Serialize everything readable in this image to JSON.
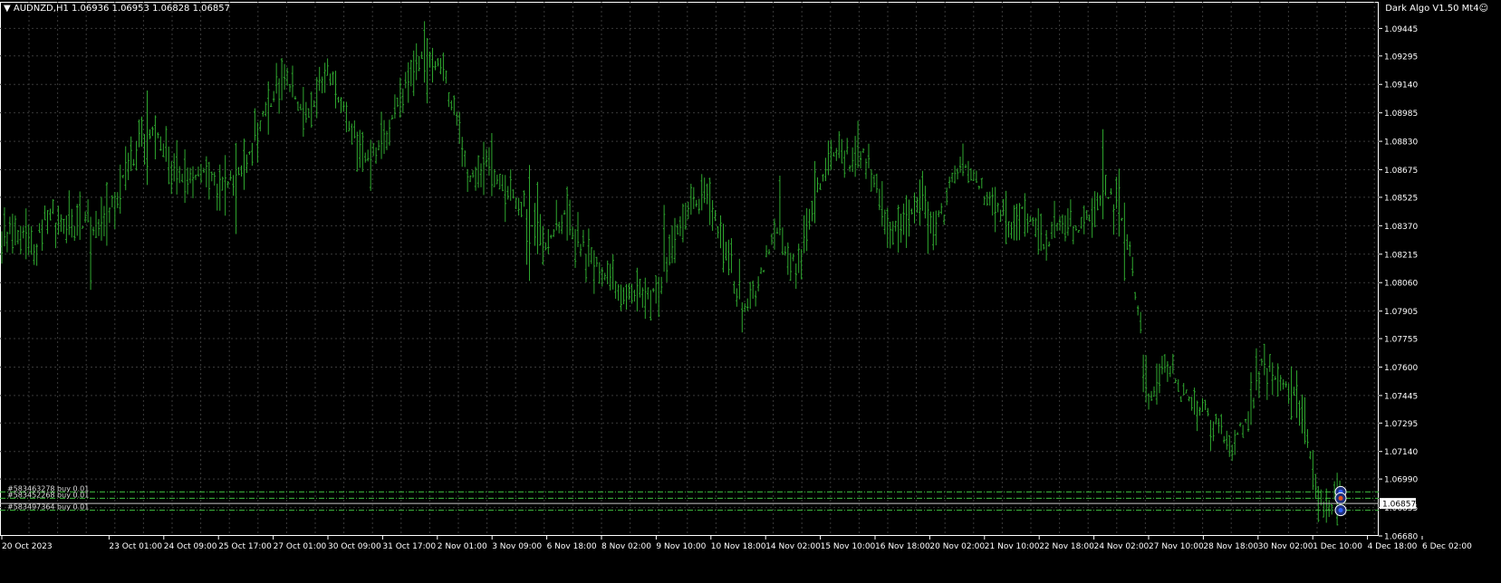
{
  "header": {
    "symbol_line": "▼ AUDNZD,H1  1.06936 1.06953 1.06828 1.06857",
    "expert_label": "Dark Algo V1.50 Mt4☺"
  },
  "colors": {
    "background": "#000000",
    "candles": "#2fa82f",
    "grid": "#3a3a3a",
    "axis_text": "#ffffff",
    "order_line": "#3fbf3f",
    "bid_line": "#c8c8c8"
  },
  "chart_data": {
    "type": "bar",
    "symbol": "AUDNZD",
    "timeframe": "H1",
    "ohlc_last": {
      "open": 1.06936,
      "high": 1.06953,
      "low": 1.06828,
      "close": 1.06857
    },
    "ylim": [
      1.0668,
      1.0959
    ],
    "price_ticks": [
      "1.09445",
      "1.09295",
      "1.09140",
      "1.08985",
      "1.08830",
      "1.08675",
      "1.08525",
      "1.08370",
      "1.08215",
      "1.08060",
      "1.07905",
      "1.07755",
      "1.07600",
      "1.07445",
      "1.07295",
      "1.07140",
      "1.06990",
      "1.06835",
      "1.06680"
    ],
    "time_ticks": [
      "20 Oct 2023",
      "23 Oct 01:00",
      "24 Oct 09:00",
      "25 Oct 17:00",
      "27 Oct 01:00",
      "30 Oct 09:00",
      "31 Oct 17:00",
      "2 Nov 01:00",
      "3 Nov 09:00",
      "6 Nov 18:00",
      "8 Nov 02:00",
      "9 Nov 10:00",
      "10 Nov 18:00",
      "14 Nov 02:00",
      "15 Nov 10:00",
      "16 Nov 18:00",
      "20 Nov 02:00",
      "21 Nov 10:00",
      "22 Nov 18:00",
      "24 Nov 02:00",
      "27 Nov 10:00",
      "28 Nov 18:00",
      "30 Nov 02:00",
      "1 Dec 10:00",
      "4 Dec 18:00",
      "6 Dec 02:00"
    ],
    "price_path": [
      [
        0,
        1.0834
      ],
      [
        8,
        1.0834
      ],
      [
        14,
        1.0828
      ],
      [
        18,
        1.0843
      ],
      [
        25,
        1.0838
      ],
      [
        32,
        1.084
      ],
      [
        38,
        1.0836
      ],
      [
        44,
        1.0848
      ],
      [
        50,
        1.0872
      ],
      [
        54,
        1.0885
      ],
      [
        58,
        1.0893
      ],
      [
        62,
        1.0878
      ],
      [
        66,
        1.087
      ],
      [
        72,
        1.0862
      ],
      [
        78,
        1.0865
      ],
      [
        84,
        1.0858
      ],
      [
        90,
        1.0862
      ],
      [
        96,
        1.0875
      ],
      [
        102,
        1.09
      ],
      [
        106,
        1.091
      ],
      [
        110,
        1.0912
      ],
      [
        114,
        1.0905
      ],
      [
        118,
        1.0898
      ],
      [
        122,
        1.0908
      ],
      [
        126,
        1.0922
      ],
      [
        130,
        1.0912
      ],
      [
        134,
        1.0895
      ],
      [
        138,
        1.088
      ],
      [
        142,
        1.0874
      ],
      [
        146,
        1.088
      ],
      [
        150,
        1.089
      ],
      [
        154,
        1.0902
      ],
      [
        158,
        1.0915
      ],
      [
        162,
        1.0928
      ],
      [
        166,
        1.093
      ],
      [
        170,
        1.0922
      ],
      [
        174,
        1.0905
      ],
      [
        178,
        1.0878
      ],
      [
        182,
        1.0862
      ],
      [
        186,
        1.0872
      ],
      [
        190,
        1.0868
      ],
      [
        194,
        1.0856
      ],
      [
        198,
        1.0852
      ],
      [
        202,
        1.0848
      ],
      [
        206,
        1.0835
      ],
      [
        210,
        1.0826
      ],
      [
        214,
        1.0836
      ],
      [
        218,
        1.0844
      ],
      [
        222,
        1.083
      ],
      [
        226,
        1.0822
      ],
      [
        230,
        1.0815
      ],
      [
        234,
        1.0808
      ],
      [
        238,
        1.08
      ],
      [
        242,
        1.0797
      ],
      [
        246,
        1.08
      ],
      [
        250,
        1.0796
      ],
      [
        254,
        1.08
      ],
      [
        258,
        1.0825
      ],
      [
        262,
        1.0836
      ],
      [
        266,
        1.0845
      ],
      [
        270,
        1.085
      ],
      [
        272,
        1.086
      ],
      [
        276,
        1.0838
      ],
      [
        280,
        1.0822
      ],
      [
        284,
        1.0806
      ],
      [
        288,
        1.079
      ],
      [
        292,
        1.0799
      ],
      [
        296,
        1.0822
      ],
      [
        300,
        1.0834
      ],
      [
        304,
        1.0826
      ],
      [
        308,
        1.0812
      ],
      [
        312,
        1.0836
      ],
      [
        316,
        1.0856
      ],
      [
        320,
        1.0876
      ],
      [
        324,
        1.0878
      ],
      [
        328,
        1.0872
      ],
      [
        332,
        1.088
      ],
      [
        336,
        1.087
      ],
      [
        340,
        1.085
      ],
      [
        344,
        1.083
      ],
      [
        348,
        1.0838
      ],
      [
        352,
        1.0844
      ],
      [
        356,
        1.0848
      ],
      [
        360,
        1.0835
      ],
      [
        364,
        1.0842
      ],
      [
        368,
        1.0862
      ],
      [
        372,
        1.0872
      ],
      [
        376,
        1.0866
      ],
      [
        380,
        1.0852
      ],
      [
        384,
        1.085
      ],
      [
        388,
        1.0842
      ],
      [
        392,
        1.0838
      ],
      [
        396,
        1.0845
      ],
      [
        400,
        1.0835
      ],
      [
        404,
        1.0828
      ],
      [
        408,
        1.0836
      ],
      [
        412,
        1.0838
      ],
      [
        416,
        1.083
      ],
      [
        420,
        1.084
      ],
      [
        424,
        1.0852
      ],
      [
        428,
        1.0855
      ],
      [
        432,
        1.0848
      ],
      [
        436,
        1.083
      ],
      [
        440,
        1.079
      ],
      [
        444,
        1.074
      ],
      [
        448,
        1.0755
      ],
      [
        452,
        1.0762
      ],
      [
        456,
        1.0748
      ],
      [
        460,
        1.074
      ],
      [
        464,
        1.0738
      ],
      [
        468,
        1.0728
      ],
      [
        472,
        1.0727
      ],
      [
        476,
        1.071
      ],
      [
        480,
        1.0727
      ],
      [
        484,
        1.0743
      ],
      [
        488,
        1.076
      ],
      [
        492,
        1.0757
      ],
      [
        496,
        1.0748
      ],
      [
        500,
        1.0742
      ],
      [
        504,
        1.0736
      ],
      [
        506,
        1.072
      ],
      [
        508,
        1.0693
      ],
      [
        512,
        1.0682
      ],
      [
        516,
        1.0686
      ],
      [
        520,
        1.0688
      ]
    ]
  },
  "orders": [
    {
      "label": "#583463278 buy 0.01",
      "price": 1.0692
    },
    {
      "label": "#583452268 buy 0.01",
      "price": 1.06885
    },
    {
      "label": "#583497364 buy 0.01",
      "price": 1.0682
    }
  ],
  "current_price": "1.06857",
  "bid_price": 1.06857
}
